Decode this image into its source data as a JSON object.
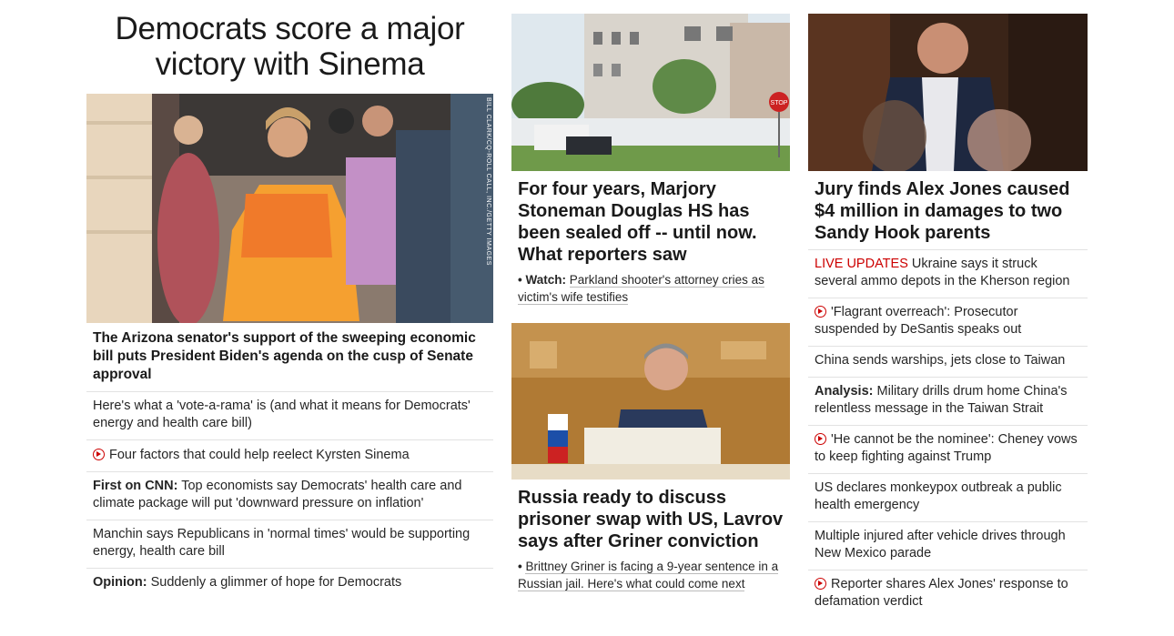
{
  "col1": {
    "headline": "Democrats score a major victory with Sinema",
    "photo_credit": "BILL CLARK/CQ-ROLL CALL, INC./GETTY IMAGES",
    "lead": "The Arizona senator's support of the sweeping economic bill puts President Biden's agenda on the cusp of Senate approval",
    "items": [
      {
        "kicker": "",
        "text": "Here's what a 'vote-a-rama' is (and what it means for Democrats' energy and health care bill)",
        "video": false
      },
      {
        "kicker": "",
        "text": "Four factors that could help reelect Kyrsten Sinema",
        "video": true
      },
      {
        "kicker": "First on CNN:",
        "text": "Top economists say Democrats' health care and climate package will put 'downward pressure on inflation'",
        "video": false
      },
      {
        "kicker": "",
        "text": "Manchin says Republicans in 'normal times' would be supporting energy, health care bill",
        "video": false
      },
      {
        "kicker": "Opinion:",
        "text": "Suddenly a glimmer of hope for Democrats",
        "video": false
      }
    ]
  },
  "col2": {
    "story1": {
      "title": "For four years, Marjory Stoneman Douglas HS has been sealed off -- until now. What reporters saw",
      "bullet_kicker": "Watch:",
      "bullet_text": "Parkland shooter's attorney cries as victim's wife testifies"
    },
    "story2": {
      "title": "Russia ready to discuss prisoner swap with US, Lavrov says after Griner conviction",
      "bullet_text": "Brittney Griner is facing a 9-year sentence in a Russian jail. Here's what could come next"
    },
    "stop_sign": "STOP"
  },
  "col3": {
    "title": "Jury finds Alex Jones caused $4 million in damages to two Sandy Hook parents",
    "items": [
      {
        "live": "LIVE UPDATES",
        "kicker": "",
        "text": "Ukraine says it struck several ammo depots in the Kherson region",
        "video": false
      },
      {
        "live": "",
        "kicker": "",
        "text": "'Flagrant overreach': Prosecutor suspended by DeSantis speaks out",
        "video": true
      },
      {
        "live": "",
        "kicker": "",
        "text": "China sends warships, jets close to Taiwan",
        "video": false
      },
      {
        "live": "",
        "kicker": "Analysis:",
        "text": "Military drills drum home China's relentless message in the Taiwan Strait",
        "video": false
      },
      {
        "live": "",
        "kicker": "",
        "text": "'He cannot be the nominee': Cheney vows to keep fighting against Trump",
        "video": true
      },
      {
        "live": "",
        "kicker": "",
        "text": "US declares monkeypox outbreak a public health emergency",
        "video": false
      },
      {
        "live": "",
        "kicker": "",
        "text": "Multiple injured after vehicle drives through New Mexico parade",
        "video": false
      },
      {
        "live": "",
        "kicker": "",
        "text": "Reporter shares Alex Jones' response to defamation verdict",
        "video": true
      }
    ]
  },
  "colors": {
    "accent_red": "#cc0000",
    "divider": "#e2e2e2"
  }
}
